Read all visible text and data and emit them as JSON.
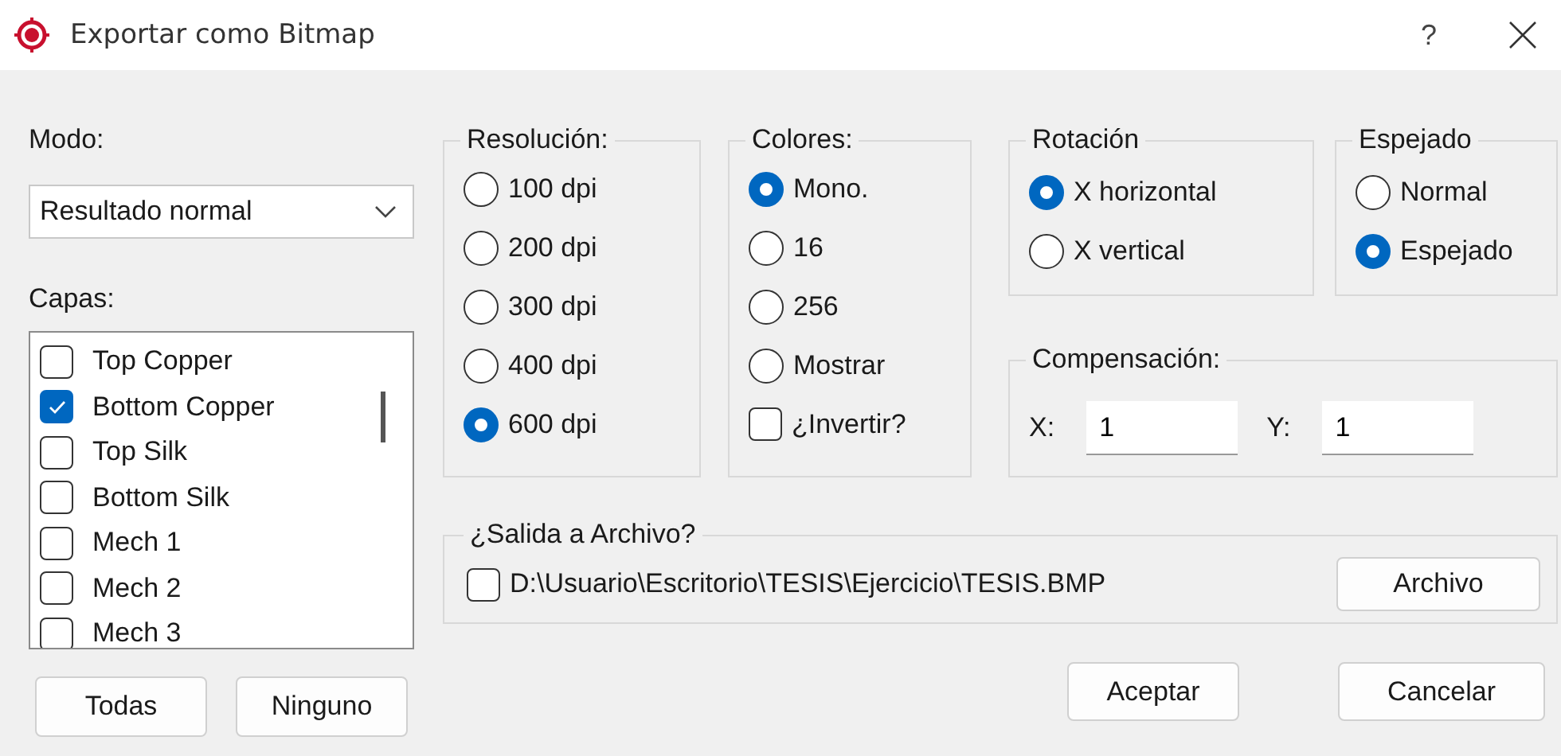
{
  "window": {
    "title": "Exportar como Bitmap",
    "help": "?"
  },
  "mode": {
    "label": "Modo:",
    "value": "Resultado normal"
  },
  "layers": {
    "label": "Capas:",
    "items": [
      {
        "name": "Top Copper",
        "checked": false
      },
      {
        "name": "Bottom Copper",
        "checked": true
      },
      {
        "name": "Top Silk",
        "checked": false
      },
      {
        "name": "Bottom Silk",
        "checked": false
      },
      {
        "name": "Mech 1",
        "checked": false
      },
      {
        "name": "Mech 2",
        "checked": false
      },
      {
        "name": "Mech 3",
        "checked": false
      }
    ]
  },
  "layer_buttons": [
    "Todas",
    "Ninguno"
  ],
  "resolution": {
    "label": "Resolución:",
    "options": [
      {
        "label": "100 dpi",
        "selected": false
      },
      {
        "label": "200 dpi",
        "selected": false
      },
      {
        "label": "300 dpi",
        "selected": false
      },
      {
        "label": "400 dpi",
        "selected": false
      },
      {
        "label": "600 dpi",
        "selected": true
      }
    ]
  },
  "colors": {
    "label": "Colores:",
    "options": [
      {
        "label": "Mono.",
        "selected": true
      },
      {
        "label": "16",
        "selected": false
      },
      {
        "label": "256",
        "selected": false
      },
      {
        "label": "Mostrar",
        "selected": false
      }
    ],
    "invert": {
      "label": "¿Invertir?",
      "checked": false
    }
  },
  "rotation": {
    "label": "Rotación",
    "options": [
      {
        "label": "X horizontal",
        "selected": true
      },
      {
        "label": "X vertical",
        "selected": false
      }
    ]
  },
  "mirror": {
    "label": "Espejado",
    "options": [
      {
        "label": "Normal",
        "selected": false
      },
      {
        "label": "Espejado",
        "selected": true
      }
    ]
  },
  "offset": {
    "label": "Compensación:",
    "x": {
      "label": "X:",
      "value": "1"
    },
    "y": {
      "label": "Y:",
      "value": "1"
    }
  },
  "output": {
    "label": "¿Salida a Archivo?",
    "file": {
      "label": "D:\\Usuario\\Escritorio\\TESIS\\Ejercicio\\TESIS.BMP",
      "checked": false
    },
    "button": "Archivo"
  },
  "buttons": [
    "Aceptar",
    "Cancelar"
  ]
}
